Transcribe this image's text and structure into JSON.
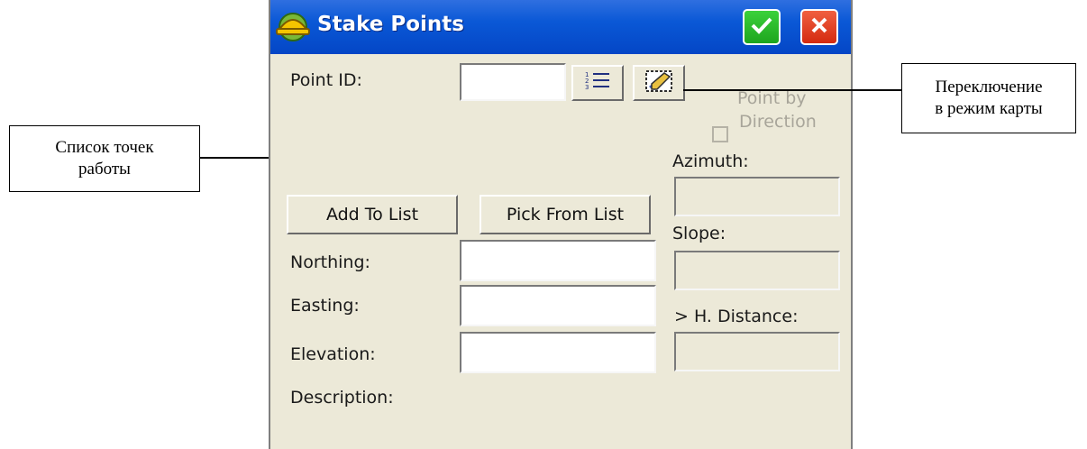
{
  "window": {
    "title": "Stake Points"
  },
  "form": {
    "point_id_label": "Point ID:",
    "point_id_value": "",
    "point_by_direction_line1": "Point by",
    "point_by_direction_line2": "Direction",
    "azimuth_label": "Azimuth:",
    "azimuth_value": "",
    "slope_label": "Slope:",
    "slope_value": "",
    "h_distance_label": "> H. Distance:",
    "h_distance_value": "",
    "add_to_list": "Add To List",
    "pick_from_list": "Pick From List",
    "northing_label": "Northing:",
    "northing_value": "",
    "easting_label": "Easting:",
    "easting_value": "",
    "elevation_label": "Elevation:",
    "elevation_value": "",
    "description_label": "Description:"
  },
  "callouts": {
    "map_mode_line1": "Переключение",
    "map_mode_line2": "в режим карты",
    "point_list_line1": "Список точек",
    "point_list_line2": "работы"
  }
}
